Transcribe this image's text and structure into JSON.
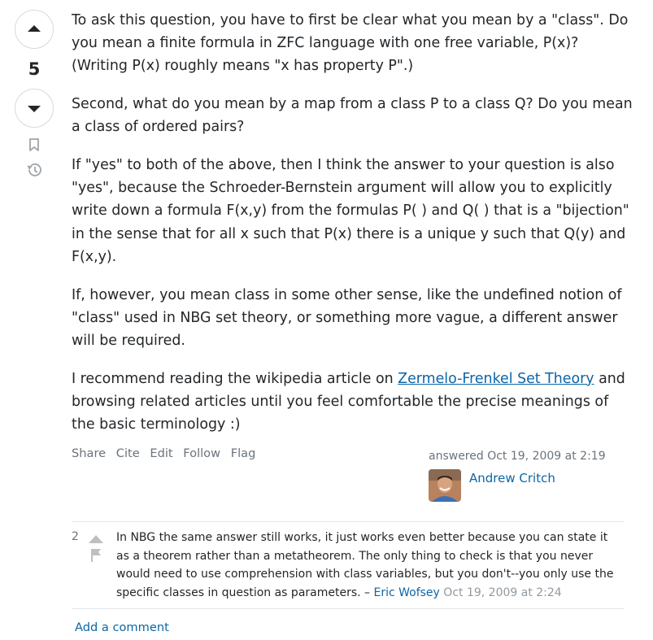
{
  "vote": {
    "score": "5"
  },
  "answer": {
    "paragraphs": [
      "To ask this question, you have to first be clear what you mean by a \"class\". Do you mean a finite formula in ZFC language with one free variable, P(x)? (Writing P(x) roughly means \"x has property P\".)",
      "Second, what do you mean by a map from a class P to a class Q? Do you mean a class of ordered pairs?",
      "If \"yes\" to both of the above, then I think the answer to your question is also \"yes\", because the Schroeder-Bernstein argument will allow you to explicitly write down a formula F(x,y) from the formulas P( ) and Q( ) that is a \"bijection\" in the sense that for all x such that P(x) there is a unique y such that Q(y) and F(x,y).",
      "If, however, you mean class in some other sense, like the undefined notion of \"class\" used in NBG set theory, or something more vague, a different answer will be required."
    ],
    "last_paragraph": {
      "before": "I recommend reading the wikipedia article on ",
      "link": "Zermelo-Frenkel Set Theory",
      "after": " and browsing related articles until you feel comfortable the precise meanings of the basic terminology :)"
    }
  },
  "menu": {
    "share": "Share",
    "cite": "Cite",
    "edit": "Edit",
    "follow": "Follow",
    "flag": "Flag"
  },
  "signature": {
    "action": "answered Oct 19, 2009 at 2:19",
    "user": "Andrew Critch"
  },
  "comment": {
    "score": "2",
    "text": "In NBG the same answer still works, it just works even better because you can state it as a theorem rather than a metatheorem. The only thing to check is that you never would need to use comprehension with class variables, but you don't--you only use the specific classes in question as parameters. – ",
    "user": "Eric Wofsey",
    "date": "Oct 19, 2009 at 2:24"
  },
  "add_comment": "Add a comment",
  "icons": {
    "upvote": "arrow-up-icon",
    "downvote": "arrow-down-icon",
    "bookmark": "bookmark-icon",
    "history": "history-icon",
    "flag": "flag-icon"
  },
  "colors": {
    "link": "#0c65a6",
    "muted": "#6a737c",
    "border": "#d6d9dc"
  }
}
